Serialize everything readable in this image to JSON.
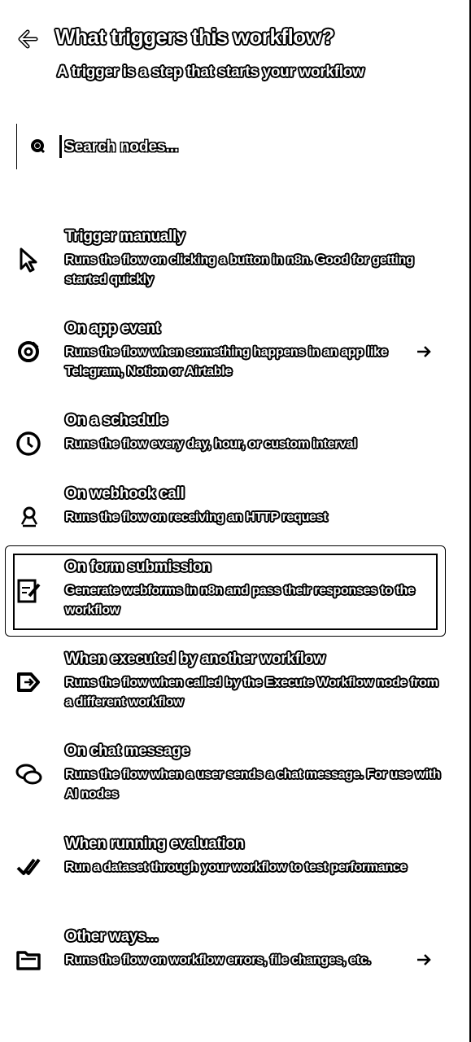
{
  "header": {
    "title": "What triggers this workflow?",
    "subtitle": "A trigger is a step that starts your workflow"
  },
  "search": {
    "placeholder": "Search nodes..."
  },
  "items": [
    {
      "title": "Trigger manually",
      "desc": "Runs the flow on clicking a button in n8n. Good for getting started quickly",
      "icon": "cursor-icon",
      "arrow": false
    },
    {
      "title": "On app event",
      "desc": "Runs the flow when something happens in an app like Telegram, Notion or Airtable",
      "icon": "app-event-icon",
      "arrow": true
    },
    {
      "title": "On a schedule",
      "desc": "Runs the flow every day, hour, or custom interval",
      "icon": "clock-icon",
      "arrow": false
    },
    {
      "title": "On webhook call",
      "desc": "Runs the flow on receiving an HTTP request",
      "icon": "webhook-icon",
      "arrow": false
    },
    {
      "title": "On form submission",
      "desc": "Generate webforms in n8n and pass their responses to the workflow",
      "icon": "form-icon",
      "arrow": false,
      "selected": true
    },
    {
      "title": "When executed by another workflow",
      "desc": "Runs the flow when called by the Execute Workflow node from a different workflow",
      "icon": "execute-workflow-icon",
      "arrow": false
    },
    {
      "title": "On chat message",
      "desc": "Runs the flow when a user sends a chat message. For use with AI nodes",
      "icon": "chat-icon",
      "arrow": false
    },
    {
      "title": "When running evaluation",
      "desc": "Run a dataset through your workflow to test performance",
      "icon": "check-double-icon",
      "arrow": false
    },
    {
      "title": "Other ways...",
      "desc": "Runs the flow on workflow errors, file changes, etc.",
      "icon": "folder-icon",
      "arrow": true
    }
  ]
}
